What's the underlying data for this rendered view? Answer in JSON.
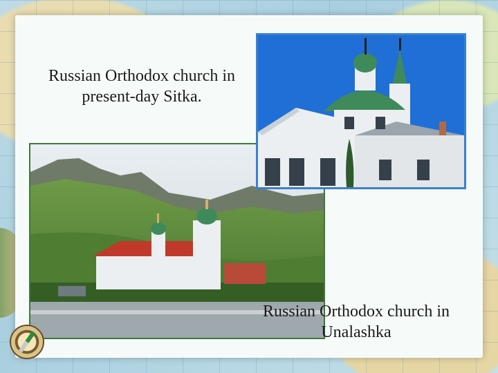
{
  "slide": {
    "caption_sitka": "Russian Orthodox church in present-day Sitka.",
    "caption_unalaska": "Russian Orthodox church in Unalashka"
  },
  "colors": {
    "sitka_sky": "#1f6fd6",
    "dome_green": "#3f8a5a",
    "church_white": "#eceff1",
    "unalaska_hill": "#5e8f3c",
    "roof_red": "#c0392b"
  },
  "icons": [
    "compass-icon",
    "globe-icon"
  ]
}
